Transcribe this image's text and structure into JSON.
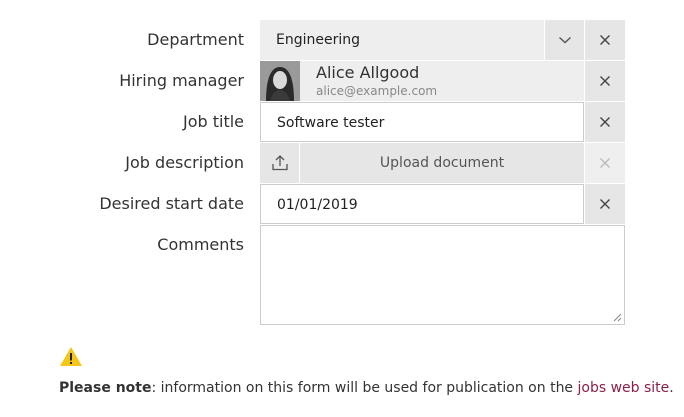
{
  "form": {
    "department": {
      "label": "Department",
      "value": "Engineering"
    },
    "hiring_manager": {
      "label": "Hiring manager",
      "name": "Alice Allgood",
      "email": "alice@example.com"
    },
    "job_title": {
      "label": "Job title",
      "value": "Software tester"
    },
    "job_description": {
      "label": "Job description",
      "upload_label": "Upload document"
    },
    "start_date": {
      "label": "Desired start date",
      "value": "01/01/2019"
    },
    "comments": {
      "label": "Comments",
      "value": ""
    }
  },
  "note": {
    "strong": "Please note",
    "text": ": information on this form will be used for publication on the ",
    "link": "jobs web site",
    "end": "."
  },
  "icons": {
    "clear": "close-icon",
    "dropdown": "chevron-down-icon",
    "upload": "upload-icon",
    "warning": "warning-icon"
  },
  "colors": {
    "field_bg": "#eeeeee",
    "button_bg": "#e6e6e6",
    "link": "#8a1f4d",
    "warning": "#f5c518"
  }
}
